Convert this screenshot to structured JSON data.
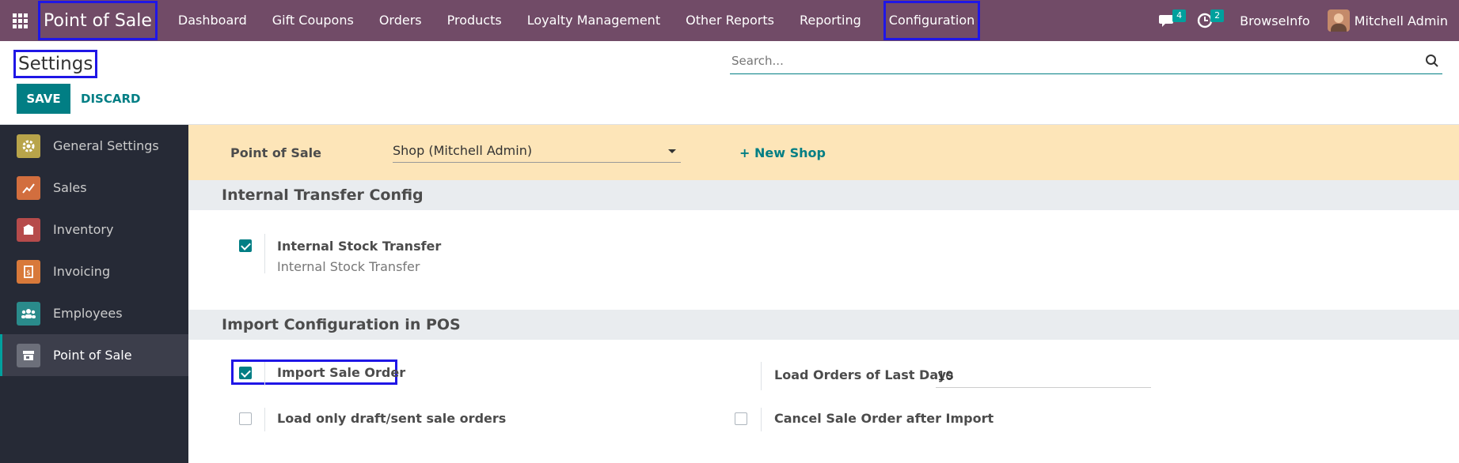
{
  "navbar": {
    "app_name": "Point of Sale",
    "menu": [
      "Dashboard",
      "Gift Coupons",
      "Orders",
      "Products",
      "Loyalty Management",
      "Other Reports",
      "Reporting",
      "Configuration"
    ],
    "messages_count": "4",
    "activities_count": "2",
    "company": "BrowseInfo",
    "user": "Mitchell Admin",
    "bg_color": "#714b67"
  },
  "control": {
    "title": "Settings",
    "save_label": "SAVE",
    "discard_label": "DISCARD",
    "search_placeholder": "Search..."
  },
  "sidebar": {
    "items": [
      {
        "label": "General Settings",
        "icon": "gear-icon",
        "color": "#b8a44a"
      },
      {
        "label": "Sales",
        "icon": "chart-icon",
        "color": "#d26e3e"
      },
      {
        "label": "Inventory",
        "icon": "box-icon",
        "color": "#b64b4b"
      },
      {
        "label": "Invoicing",
        "icon": "invoice-icon",
        "color": "#d8793a"
      },
      {
        "label": "Employees",
        "icon": "people-icon",
        "color": "#2a8b8b"
      },
      {
        "label": "Point of Sale",
        "icon": "store-icon",
        "color": "#6c6f7a",
        "active": true
      }
    ]
  },
  "main": {
    "pos_label": "Point of Sale",
    "pos_value": "Shop (Mitchell Admin)",
    "new_shop": "+ New Shop",
    "section1": {
      "title": "Internal Transfer Config",
      "setting_title": "Internal Stock Transfer",
      "setting_desc": "Internal Stock Transfer",
      "checked": true
    },
    "section2": {
      "title": "Import Configuration in POS",
      "import_sale_order": "Import Sale Order",
      "load_days_label": "Load Orders of Last Days",
      "load_days_value": "10",
      "draft_only": "Load only draft/sent sale orders",
      "cancel_after_import": "Cancel Sale Order after Import"
    },
    "accent_color": "#017e84"
  }
}
